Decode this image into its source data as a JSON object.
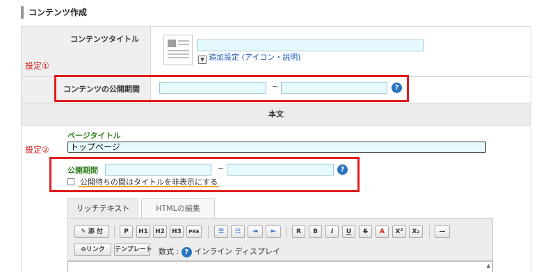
{
  "section_title": "コンテンツ作成",
  "form": {
    "content_title_label": "コンテンツタイトル",
    "additional_settings_link": "追加設定 (アイコン・説明)",
    "content_period_label": "コンテンツの公開期間",
    "period_separator": "~",
    "help_glyph": "?",
    "body_header": "本文"
  },
  "annotations": {
    "setting_1": "設定①",
    "setting_2": "設定②",
    "highlight_color": "#e01c1c",
    "underline_color": "#f0a52a"
  },
  "page": {
    "page_title_label": "ページタイトル",
    "page_title_value": "トップページ",
    "publish_period_label": "公開期間",
    "period_separator": "~",
    "help_glyph": "?",
    "hide_title_checkbox_label": "公開待ちの間はタイトルを非表示にする",
    "hide_title_checked": false
  },
  "editor": {
    "tabs": [
      "リッチテキスト",
      "HTMLの編集"
    ],
    "active_tab": "リッチテキスト",
    "toolbar_row1": [
      "添付",
      "P",
      "H1",
      "H2",
      "H3",
      "PRE",
      "ordered-list-icon",
      "bullet-list-icon",
      "indent-icon",
      "outdent-icon",
      "R",
      "B",
      "I",
      "U",
      "S",
      "A",
      "X²",
      "X₂",
      "horizontal-rule-icon"
    ],
    "attach_label": "添 付",
    "link_label": "リンク",
    "template_label": "テンプレート",
    "formula_label": "数式 :",
    "inline_label": "インライン",
    "display_label": "ディスプレイ",
    "scroll_up_glyph": "▲"
  },
  "colors": {
    "input_bg": "#e6fafd",
    "green_label": "#2f7d1e",
    "link_blue": "#1a55b8",
    "help_blue": "#2a74c0"
  }
}
